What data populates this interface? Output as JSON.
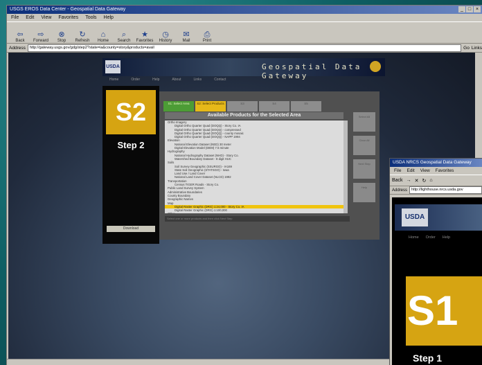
{
  "main_window": {
    "title": "USGS EROS Data Center - Geospatial Data Gateway",
    "menu": [
      "File",
      "Edit",
      "View",
      "Favorites",
      "Tools",
      "Help"
    ],
    "toolbar": [
      "Back",
      "Forward",
      "Stop",
      "Refresh",
      "Home",
      "Search",
      "Favorites",
      "History",
      "Mail",
      "Print"
    ],
    "address_label": "Address",
    "address": "http://gateway.usgs.gov/gdg/step2?state=ia&county=story&products=avail",
    "go_label": "Go",
    "links_label": "Links"
  },
  "site": {
    "banner_title": "Geospatial Data Gateway",
    "logo": "USDA",
    "nav": [
      "Home",
      "Order",
      "Help",
      "About",
      "Links",
      "Contact"
    ],
    "step_badge": "S2",
    "step_label": "Step 2",
    "download_button": "Download",
    "tabs": [
      {
        "label": "S1: Select Area",
        "style": "green"
      },
      {
        "label": "S2: Select Products",
        "style": "yellow"
      },
      {
        "label": "S3",
        "style": "gray"
      },
      {
        "label": "S4",
        "style": "gray"
      },
      {
        "label": "S5",
        "style": "gray"
      }
    ],
    "panel_heading": "Available Products for the Selected Area",
    "list_items": [
      "Ortho Imagery",
      "Digital Ortho Quarter Quad (DOQQ) - Story Co. IA",
      "Digital Ortho Quarter Quad (DOQQ) - compressed",
      "Digital Ortho Quarter Quad (DOQQ) - county mosaic",
      "Digital Ortho Quarter Quad (DOQQ) - NAPP 1994",
      "Elevation",
      "National Elevation Dataset (NED) 30 meter",
      "Digital Elevation Model (DEM) 7.5 minute",
      "Hydrography",
      "National Hydrography Dataset (NHD) - Story Co.",
      "Watershed Boundary Dataset - 8 digit HUC",
      "Soils",
      "Soil Survey Geographic (SSURGO) - IA169",
      "State Soil Geographic (STATSGO) - Iowa",
      "Land Use / Land Cover",
      "National Land Cover Dataset (NLCD) 1992",
      "Transportation",
      "Census TIGER Roads - Story Co.",
      "Public Land Survey System",
      "Administrative Boundaries",
      "County Boundary",
      "Geographic Names",
      "Map",
      "Digital Raster Graphic (DRG) 1:24,000 - Story Co. IA",
      "Digital Raster Graphic (DRG) 1:100,000",
      "Other"
    ],
    "selected_index": 23,
    "side_buttons": [
      "Select All",
      "Clear All",
      "Next Step",
      "Help"
    ],
    "panel_footer": "Select one or more products and then click Next Step"
  },
  "second_window": {
    "title": "USDA NRCS Geospatial Data Gateway",
    "menu": [
      "File",
      "Edit",
      "View",
      "Favorites"
    ],
    "toolbar": [
      "Back",
      "→",
      "✕",
      "↻",
      "⌂"
    ],
    "address_label": "Address",
    "address": "http://lighthouse.nrcs.usda.gov",
    "logo": "USDA",
    "nav": [
      "Home",
      "Order",
      "Help"
    ],
    "step_badge": "S1",
    "step_label": "Step 1"
  }
}
